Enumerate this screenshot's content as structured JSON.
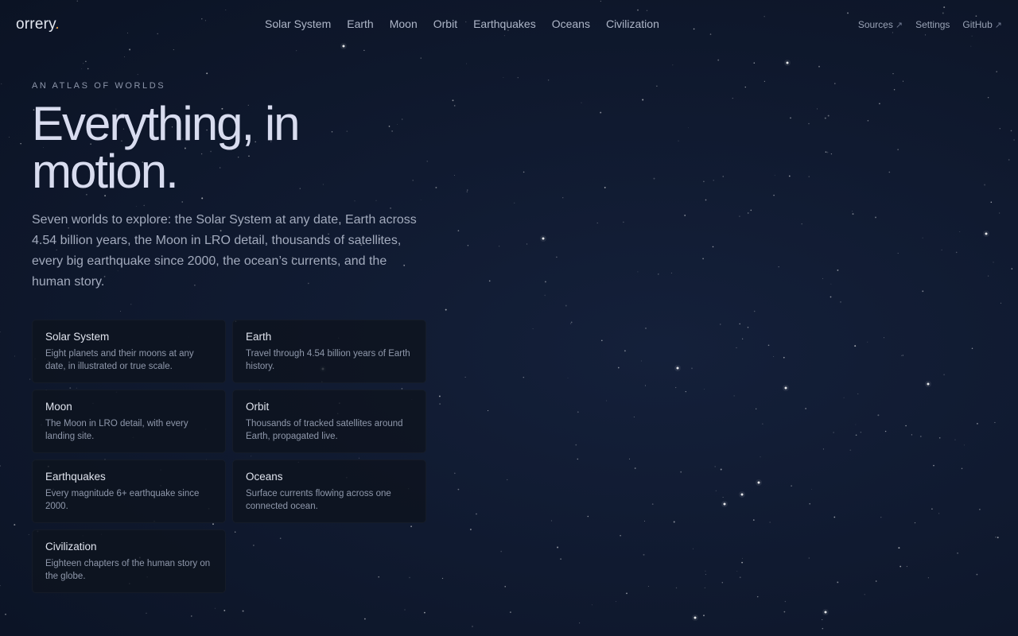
{
  "brand": {
    "name": "orrery",
    "dot": "."
  },
  "nav": {
    "items": [
      "Solar System",
      "Earth",
      "Moon",
      "Orbit",
      "Earthquakes",
      "Oceans",
      "Civilization"
    ]
  },
  "utility": {
    "sources": "Sources",
    "settings": "Settings",
    "github": "GitHub",
    "external_arrow": "↗"
  },
  "hero": {
    "eyebrow": "AN ATLAS OF WORLDS",
    "headline": "Everything, in motion.",
    "lede": "Seven worlds to explore: the Solar System at any date, Earth across 4.54 billion years, the Moon in LRO detail, thousands of satellites, every big earthquake since 2000, the ocean’s currents, and the human story."
  },
  "cards": [
    {
      "title": "Solar System",
      "desc": "Eight planets and their moons at any date, in illustrated or true scale."
    },
    {
      "title": "Earth",
      "desc": "Travel through 4.54 billion years of Earth history."
    },
    {
      "title": "Moon",
      "desc": "The Moon in LRO detail, with every landing site."
    },
    {
      "title": "Orbit",
      "desc": "Thousands of tracked satellites around Earth, propagated live."
    },
    {
      "title": "Earthquakes",
      "desc": "Every magnitude 6+ earthquake since 2000."
    },
    {
      "title": "Oceans",
      "desc": "Surface currents flowing across one connected ocean."
    },
    {
      "title": "Civilization",
      "desc": "Eighteen chapters of the human story on the globe."
    }
  ],
  "colors": {
    "background": "#101a30",
    "accent_dot": "#e8a04a",
    "card_bg": "#0e141e"
  }
}
